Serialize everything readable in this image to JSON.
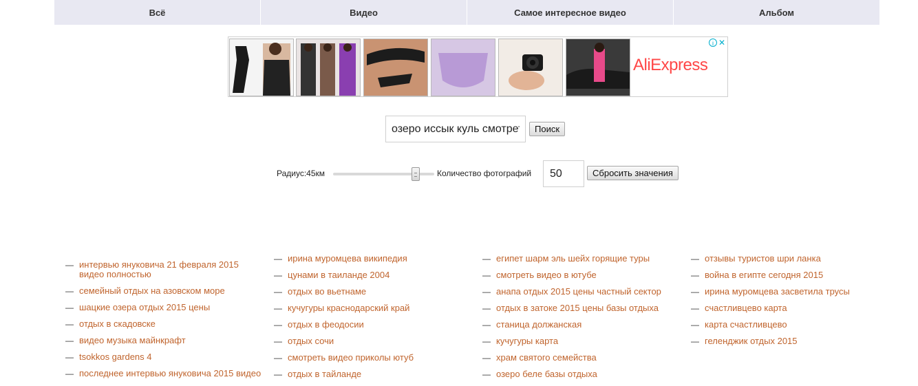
{
  "tabs": [
    "Всё",
    "Видео",
    "Самое интересное видео",
    "Альбом"
  ],
  "ad": {
    "logo_text": "AliExpress",
    "info_icon": "info-icon",
    "close_icon": "close-icon",
    "thumbnails": [
      "ad-image-1",
      "ad-image-2",
      "ad-image-3",
      "ad-image-4",
      "ad-image-5",
      "ad-image-6"
    ]
  },
  "search": {
    "value": "озеро иссык куль смотреть",
    "button_label": "Поиск"
  },
  "filters": {
    "radius_label": "Радиус:45км",
    "radius_km": 45,
    "photo_count_label": "Количество фотографий",
    "photo_count_value": "50",
    "reset_label": "Сбросить значения"
  },
  "links": {
    "col1": [
      "интервью януковича 21 февраля 2015 видео полностью",
      "семейный отдых на азовском море",
      "шацкие озера отдых 2015 цены",
      "отдых в скадовске",
      "видео музыка майнкрафт",
      "tsokkos gardens 4",
      "последнее интервью януковича 2015 видео"
    ],
    "col2": [
      "ирина муромцева википедия",
      "цунами в таиланде 2004",
      "отдых во вьетнаме",
      "кучугуры краснодарский край",
      "отдых в феодосии",
      "отдых сочи",
      "смотреть видео приколы ютуб",
      "отдых в тайланде"
    ],
    "col3": [
      "египет шарм эль шейх горящие туры",
      "смотреть видео в ютубе",
      "анапа отдых 2015 цены частный сектор",
      "отдых в затоке 2015 цены базы отдыха",
      "станица должанская",
      "кучугуры карта",
      "храм святого семейства",
      "озеро беле базы отдыха"
    ],
    "col4": [
      "отзывы туристов шри ланка",
      "война в египте сегодня 2015",
      "ирина муромцева засветила трусы",
      "счастливцево карта",
      "карта счастливцево",
      "геленджик отдых 2015"
    ]
  }
}
